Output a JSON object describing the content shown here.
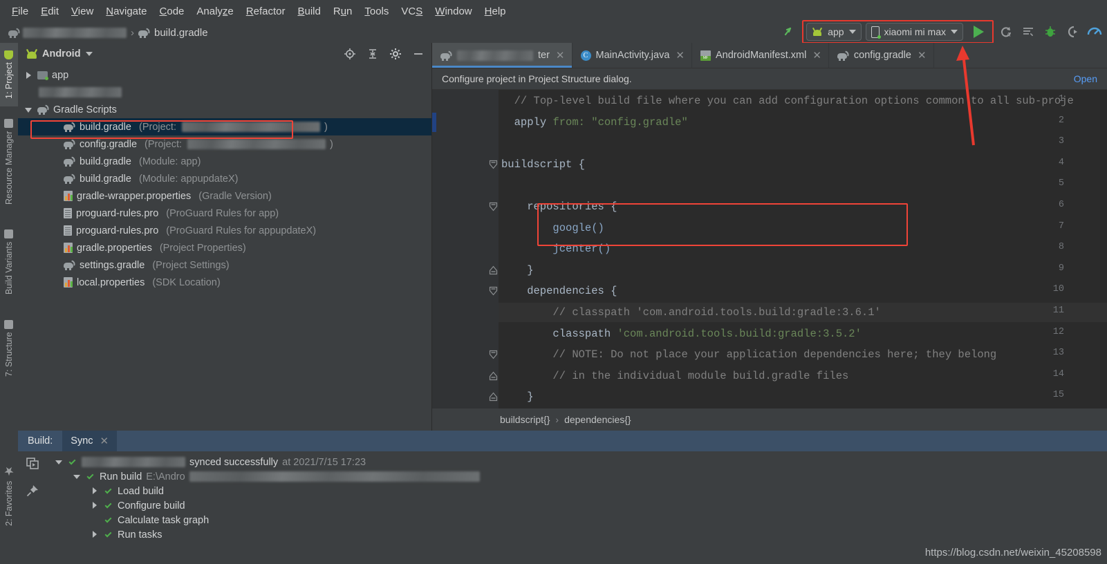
{
  "menubar": {
    "items": [
      {
        "label": "File",
        "mnemonic": "F"
      },
      {
        "label": "Edit",
        "mnemonic": "E"
      },
      {
        "label": "View",
        "mnemonic": "V"
      },
      {
        "label": "Navigate",
        "mnemonic": "N"
      },
      {
        "label": "Code",
        "mnemonic": "C"
      },
      {
        "label": "Analyze",
        "mnemonic": "z"
      },
      {
        "label": "Refactor",
        "mnemonic": "R"
      },
      {
        "label": "Build",
        "mnemonic": "B"
      },
      {
        "label": "Run",
        "mnemonic": "u"
      },
      {
        "label": "Tools",
        "mnemonic": "T"
      },
      {
        "label": "VCS",
        "mnemonic": "S"
      },
      {
        "label": "Window",
        "mnemonic": "W"
      },
      {
        "label": "Help",
        "mnemonic": "H"
      }
    ]
  },
  "navbar": {
    "project_name_redacted": "",
    "file": "build.gradle",
    "separator": "›"
  },
  "toolbar": {
    "run_config": "app",
    "device": "xiaomi mi max",
    "icons": [
      "make-project-icon",
      "run-button",
      "apply-changes-icon",
      "attach-debugger-icon",
      "debug-icon",
      "profile-icon",
      "monitor-icon"
    ],
    "highlight_color": "#e8392e"
  },
  "left_tool_strip": {
    "top_tabs": [
      {
        "label": "1: Project",
        "icon": "android-icon",
        "active": true
      },
      {
        "label": "Resource Manager",
        "icon": "resource-icon",
        "active": false
      },
      {
        "label": "Build Variants",
        "icon": "build-variants-icon",
        "active": false
      },
      {
        "label": "7: Structure",
        "icon": "structure-icon",
        "active": false
      }
    ],
    "bottom_tabs": [
      {
        "label": "2: Favorites",
        "icon": "star-icon",
        "active": false
      }
    ]
  },
  "project_panel": {
    "title": "Android",
    "header_icons": [
      "locate-icon",
      "collapse-all-icon",
      "gear-icon",
      "minimize-icon"
    ],
    "tree": [
      {
        "indent": 0,
        "twisty": "right",
        "icon": "folder",
        "label": "app",
        "sub": "",
        "selected": false,
        "redacted": false
      },
      {
        "indent": 0,
        "twisty": "none",
        "icon": "none",
        "label": "",
        "sub": "",
        "selected": false,
        "redacted": true
      },
      {
        "indent": 0,
        "twisty": "down",
        "icon": "gradle",
        "label": "Gradle Scripts",
        "sub": "",
        "selected": false,
        "redacted": false
      },
      {
        "indent": 1,
        "twisty": "none",
        "icon": "gradle",
        "label": "build.gradle",
        "sub": "(Project: ",
        "selected": true,
        "redacted": true
      },
      {
        "indent": 1,
        "twisty": "none",
        "icon": "gradle",
        "label": "config.gradle",
        "sub": "(Project: ",
        "selected": false,
        "redacted": true
      },
      {
        "indent": 1,
        "twisty": "none",
        "icon": "gradle",
        "label": "build.gradle",
        "sub": "(Module: app)",
        "selected": false,
        "redacted": false
      },
      {
        "indent": 1,
        "twisty": "none",
        "icon": "gradle",
        "label": "build.gradle",
        "sub": "(Module: appupdateX)",
        "selected": false,
        "redacted": false
      },
      {
        "indent": 1,
        "twisty": "none",
        "icon": "properties",
        "label": "gradle-wrapper.properties",
        "sub": "(Gradle Version)",
        "selected": false,
        "redacted": false
      },
      {
        "indent": 1,
        "twisty": "none",
        "icon": "doc",
        "label": "proguard-rules.pro",
        "sub": "(ProGuard Rules for app)",
        "selected": false,
        "redacted": false
      },
      {
        "indent": 1,
        "twisty": "none",
        "icon": "doc",
        "label": "proguard-rules.pro",
        "sub": "(ProGuard Rules for appupdateX)",
        "selected": false,
        "redacted": false
      },
      {
        "indent": 1,
        "twisty": "none",
        "icon": "properties",
        "label": "gradle.properties",
        "sub": "(Project Properties)",
        "selected": false,
        "redacted": false
      },
      {
        "indent": 1,
        "twisty": "none",
        "icon": "gradle",
        "label": "settings.gradle",
        "sub": "(Project Settings)",
        "selected": false,
        "redacted": false
      },
      {
        "indent": 1,
        "twisty": "none",
        "icon": "properties",
        "label": "local.properties",
        "sub": "(SDK Location)",
        "selected": false,
        "redacted": false
      }
    ]
  },
  "editor": {
    "tabs": [
      {
        "label": "",
        "icon": "gradle",
        "active": true,
        "redacted": true,
        "tail": "ter"
      },
      {
        "label": "MainActivity.java",
        "icon": "java",
        "active": false,
        "redacted": false,
        "tail": ""
      },
      {
        "label": "AndroidManifest.xml",
        "icon": "manifest",
        "active": false,
        "redacted": false,
        "tail": ""
      },
      {
        "label": "config.gradle",
        "icon": "gradle",
        "active": false,
        "redacted": false,
        "tail": ""
      }
    ],
    "notification": {
      "message": "Configure project in Project Structure dialog.",
      "link": "Open"
    },
    "breadcrumb": [
      "buildscript{}",
      "dependencies{}"
    ],
    "breadcrumb_separator": "›",
    "lines": [
      {
        "n": 1,
        "fold": "none",
        "tokens": [
          {
            "t": "  ",
            "c": "pl"
          },
          {
            "t": "// Top-level build file where you can add configuration options common to all sub-proje",
            "c": "cm"
          }
        ]
      },
      {
        "n": 2,
        "fold": "none",
        "tokens": [
          {
            "t": "  ",
            "c": "pl"
          },
          {
            "t": "apply",
            "c": "pl"
          },
          {
            "t": " ",
            "c": "pl"
          },
          {
            "t": "from:",
            "c": "str"
          },
          {
            "t": " ",
            "c": "pl"
          },
          {
            "t": "\"config.gradle\"",
            "c": "str"
          }
        ]
      },
      {
        "n": 3,
        "fold": "none",
        "tokens": [
          {
            "t": "",
            "c": "pl"
          }
        ]
      },
      {
        "n": 4,
        "fold": "start",
        "tokens": [
          {
            "t": "buildscript {",
            "c": "pl"
          }
        ]
      },
      {
        "n": 5,
        "fold": "none",
        "tokens": [
          {
            "t": "",
            "c": "pl"
          }
        ]
      },
      {
        "n": 6,
        "fold": "start",
        "tokens": [
          {
            "t": "    repositories {",
            "c": "pl"
          }
        ]
      },
      {
        "n": 7,
        "fold": "none",
        "tokens": [
          {
            "t": "        ",
            "c": "pl"
          },
          {
            "t": "google()",
            "c": "fn"
          }
        ]
      },
      {
        "n": 8,
        "fold": "none",
        "tokens": [
          {
            "t": "        ",
            "c": "pl"
          },
          {
            "t": "jcenter()",
            "c": "fn"
          }
        ]
      },
      {
        "n": 9,
        "fold": "end",
        "tokens": [
          {
            "t": "    }",
            "c": "pl"
          }
        ]
      },
      {
        "n": 10,
        "fold": "start",
        "tokens": [
          {
            "t": "    dependencies {",
            "c": "pl"
          }
        ]
      },
      {
        "n": 11,
        "fold": "none",
        "highlight": true,
        "tokens": [
          {
            "t": "        ",
            "c": "pl"
          },
          {
            "t": "// classpath 'com.android.tools.build:gradle:3.6.1'",
            "c": "cm"
          }
        ]
      },
      {
        "n": 12,
        "fold": "none",
        "tokens": [
          {
            "t": "        ",
            "c": "pl"
          },
          {
            "t": "classpath",
            "c": "pl"
          },
          {
            "t": " ",
            "c": "pl"
          },
          {
            "t": "'com.android.tools.build:gradle:3.5.2'",
            "c": "str"
          }
        ]
      },
      {
        "n": 13,
        "fold": "start",
        "tokens": [
          {
            "t": "        ",
            "c": "pl"
          },
          {
            "t": "// NOTE: Do not place your application dependencies here; they belong",
            "c": "cm"
          }
        ]
      },
      {
        "n": 14,
        "fold": "end",
        "tokens": [
          {
            "t": "        ",
            "c": "pl"
          },
          {
            "t": "// in the individual module build.gradle files",
            "c": "cm"
          }
        ]
      },
      {
        "n": 15,
        "fold": "end",
        "tokens": [
          {
            "t": "    }",
            "c": "pl"
          }
        ]
      }
    ]
  },
  "build_panel": {
    "label": "Build:",
    "tab": "Sync",
    "side_icons": [
      "restart-icon",
      "pin-icon"
    ],
    "tree": [
      {
        "indent": 0,
        "twisty": "down",
        "check": true,
        "main": "",
        "redacted": true,
        "suffix": " synced successfully ",
        "dim": "at 2021/7/15 17:23"
      },
      {
        "indent": 1,
        "twisty": "down",
        "check": true,
        "main": "Run build ",
        "redacted": false,
        "suffix": "",
        "dim": "E:\\Andro"
      },
      {
        "indent": 2,
        "twisty": "right",
        "check": true,
        "main": "Load build",
        "redacted": false,
        "suffix": "",
        "dim": ""
      },
      {
        "indent": 2,
        "twisty": "right",
        "check": true,
        "main": "Configure build",
        "redacted": false,
        "suffix": "",
        "dim": ""
      },
      {
        "indent": 2,
        "twisty": "none",
        "check": true,
        "main": "Calculate task graph",
        "redacted": false,
        "suffix": "",
        "dim": ""
      },
      {
        "indent": 2,
        "twisty": "right",
        "check": true,
        "main": "Run tasks",
        "redacted": false,
        "suffix": "",
        "dim": ""
      }
    ]
  },
  "watermark": "https://blog.csdn.net/weixin_45208598"
}
